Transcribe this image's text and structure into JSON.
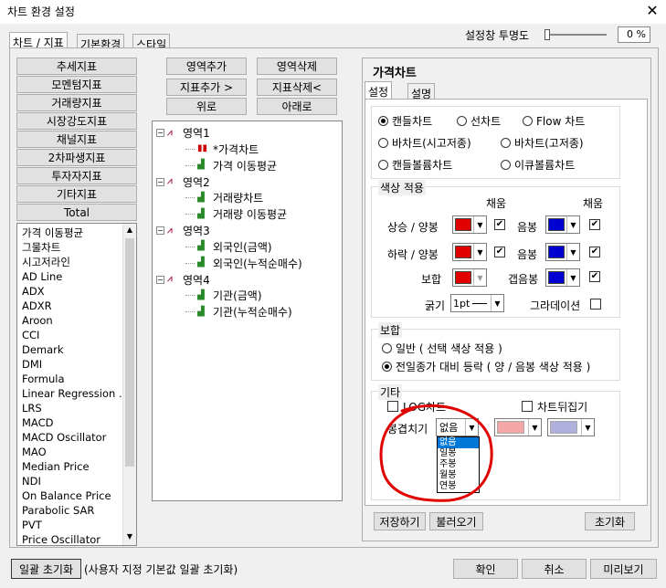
{
  "window": {
    "title": "차트 환경 설정"
  },
  "top_tabs": [
    "차트 / 지표",
    "기본환경",
    "스타일"
  ],
  "opacity": {
    "label": "설정창 투명도",
    "value": "0 %"
  },
  "category_buttons": [
    "추세지표",
    "모멘텀지표",
    "거래량지표",
    "시장강도지표",
    "채널지표",
    "2차파생지표",
    "투자자지표",
    "기타지표",
    "Total"
  ],
  "indicator_list": [
    "가격 이동평균",
    "그물차트",
    "시고저라인",
    "AD Line",
    "ADX",
    "ADXR",
    "Aroon",
    "CCI",
    "Demark",
    "DMI",
    "Formula",
    "Linear Regression ...",
    "LRS",
    "MACD",
    "MACD Oscillator",
    "MAO",
    "Median Price",
    "NDI",
    "On Balance Price",
    "Parabolic SAR",
    "PVT",
    "Price Oscillator"
  ],
  "area_buttons": {
    "add_area": "영역추가",
    "delete_area": "영역삭제",
    "add_indicator": "지표추가 >",
    "delete_indicator": "지표삭제<",
    "up": "위로",
    "down": "아래로"
  },
  "tree": [
    {
      "label": "영역1",
      "children": [
        "*가격차트",
        "가격 이동평균"
      ]
    },
    {
      "label": "영역2",
      "children": [
        "거래량차트",
        "거래량 이동평균"
      ]
    },
    {
      "label": "영역3",
      "children": [
        "외국인(금액)",
        "외국인(누적순매수)"
      ]
    },
    {
      "label": "영역4",
      "children": [
        "기관(금액)",
        "기관(누적순매수)"
      ]
    }
  ],
  "price_chart": {
    "title": "가격차트",
    "tabs": [
      "설정",
      "설명"
    ],
    "chart_types": [
      "캔들차트",
      "선차트",
      "Flow 차트",
      "바차트(시고저종)",
      "바차트(고저종)",
      "캔들볼륨차트",
      "이큐볼륨차트"
    ],
    "selected_chart_type": "캔들차트",
    "color_group": {
      "title": "색상 적용",
      "fill_header": "채움",
      "rise_label": "상승 / 양봉",
      "fall_label": "하락 / 양봉",
      "bohap_label": "보합",
      "yin_label": "음봉",
      "gap_label": "갭음봉",
      "thickness_label": "굵기",
      "thickness_value": "1pt",
      "gradation_label": "그라데이션",
      "rise_color": "#e00000",
      "yin_color": "#0000d0"
    },
    "bohap_group": {
      "title": "보합",
      "options": [
        "일반 ( 선택 색상 적용 )",
        "전일종가 대비 등락 ( 양 / 음봉 색상 적용 )"
      ],
      "selected": "전일종가 대비 등락 ( 양 / 음봉 색상 적용 )"
    },
    "etc_group": {
      "title": "기타",
      "log_label": "LOG차트",
      "flip_label": "차트뒤집기",
      "merge_label": "봉겹치기",
      "merge_value": "없음",
      "merge_options": [
        "없음",
        "일봉",
        "주봉",
        "월봉",
        "연봉"
      ],
      "merge_color1": "#f4a6a6",
      "merge_color2": "#b0b0dc"
    },
    "save_button": "저장하기",
    "load_button": "불러오기",
    "reset_button": "초기화"
  },
  "footer": {
    "reset_all_button": "일괄 초기화",
    "reset_note": "(사용자 지정 기본값 일괄 초기화)",
    "ok": "확인",
    "cancel": "취소",
    "preview": "미리보기"
  },
  "accent_colors": {
    "annotation": "#e00000"
  }
}
